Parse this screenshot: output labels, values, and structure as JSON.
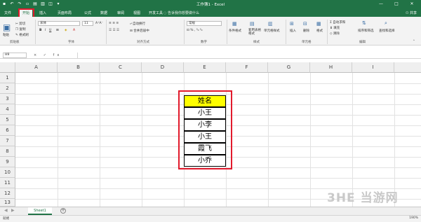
{
  "title_bar": {
    "title": "工作簿1 - Excel",
    "qat_icons": [
      "save-icon",
      "undo-icon",
      "redo-icon",
      "new-icon",
      "open-icon",
      "print-icon",
      "preview-icon",
      "more-icon"
    ],
    "minimize": "—",
    "restore": "□",
    "close": "✕"
  },
  "tabs": {
    "items": [
      "文件",
      "开始",
      "插入",
      "页面布局",
      "公式",
      "数据",
      "审阅",
      "视图",
      "开发工具"
    ],
    "active": "开始",
    "search": "告诉我你想要做什么",
    "share": "共享"
  },
  "ribbon": {
    "paste": "粘贴",
    "cut": "剪切",
    "copy": "复制",
    "format_painter": "格式刷",
    "clipboard": "剪贴板",
    "font_name": "宋体",
    "font_size": "11",
    "font": "字体",
    "wrap_text": "自动换行",
    "merge_center": "合并后居中",
    "alignment": "对齐方式",
    "number_format": "常规",
    "number": "数字",
    "conditional_formatting": "条件格式",
    "format_as_table": "套用表格格式",
    "cell_styles": "单元格样式",
    "styles": "样式",
    "insert": "插入",
    "delete": "删除",
    "format": "格式",
    "cells": "单元格",
    "autosum": "自动求和",
    "fill": "填充",
    "clear": "清除",
    "sort_filter": "排序和筛选",
    "find_select": "查找和选择",
    "editing": "编辑"
  },
  "formula_bar": {
    "name_box": "H9",
    "fx": "× ✓ fx",
    "value": ""
  },
  "sheet": {
    "columns": [
      "A",
      "B",
      "C",
      "D",
      "E",
      "F",
      "G",
      "H",
      "I"
    ],
    "rows": [
      "1",
      "2",
      "3",
      "4",
      "5",
      "6",
      "7",
      "8",
      "9",
      "10",
      "11",
      "12",
      "13"
    ],
    "cells": [
      "姓名",
      "小王",
      "小李",
      "小王",
      "霞飞",
      "小乔"
    ]
  },
  "sheet_tabs": {
    "items": [
      "Sheet1"
    ],
    "add": "+"
  },
  "status_bar": {
    "ready": "就绪",
    "zoom": "190%"
  },
  "watermark": "3HE 当游网"
}
